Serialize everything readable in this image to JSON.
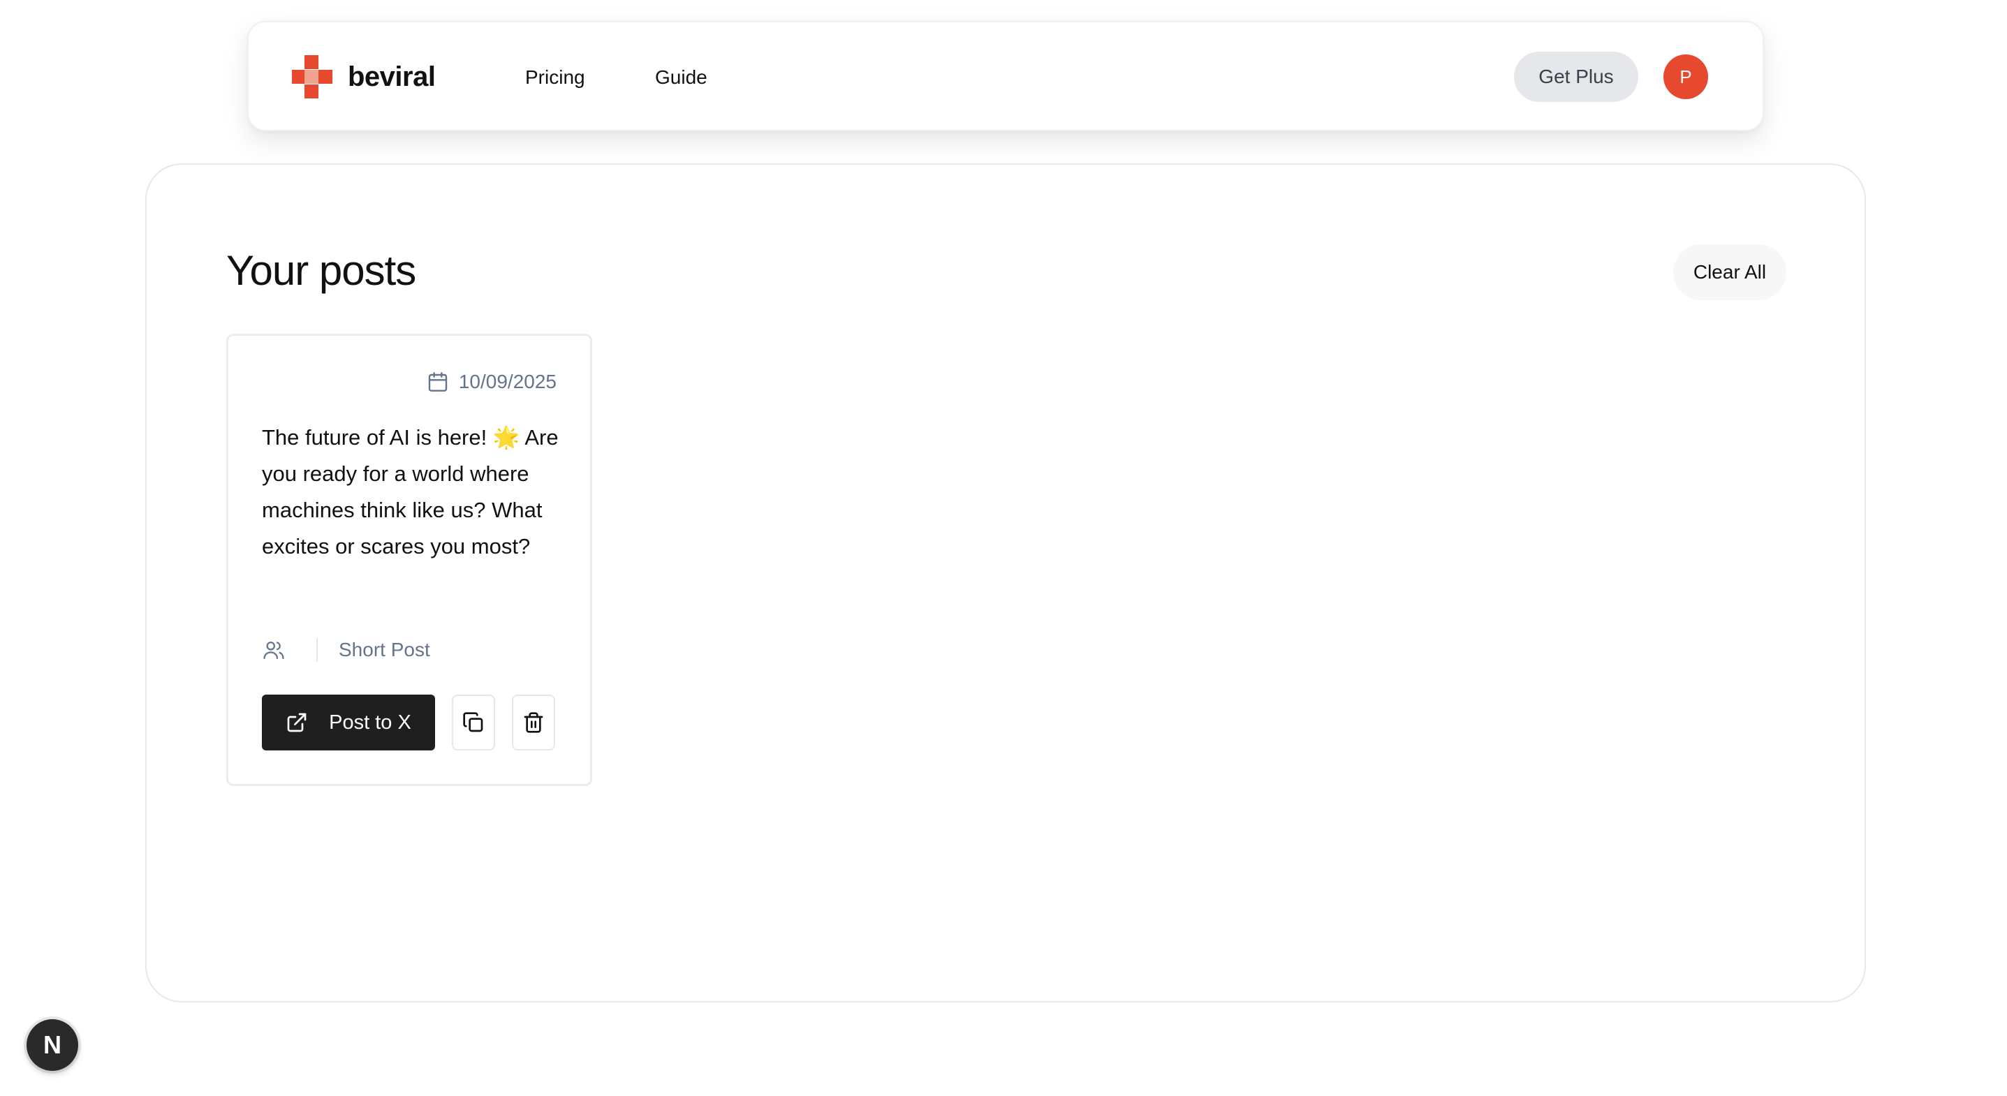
{
  "app": {
    "brand": "beviral",
    "brand_color": "#e6492d"
  },
  "nav": {
    "links": [
      {
        "label": "Pricing"
      },
      {
        "label": "Guide"
      }
    ],
    "get_plus_label": "Get Plus",
    "avatar_initial": "P"
  },
  "page": {
    "title": "Your posts",
    "clear_all_label": "Clear All"
  },
  "posts": [
    {
      "date": "10/09/2025",
      "text": "The future of AI is here! 🌟 Are you ready for a world where machines think like us? What excites or scares you most?",
      "audience_icon": "users-icon",
      "type": "Short Post",
      "post_label": "Post to X",
      "icons": {
        "date": "calendar-icon",
        "post": "external-link-icon",
        "copy": "copy-icon",
        "delete": "trash-icon"
      }
    }
  ],
  "dev_badge": {
    "letter": "N"
  }
}
